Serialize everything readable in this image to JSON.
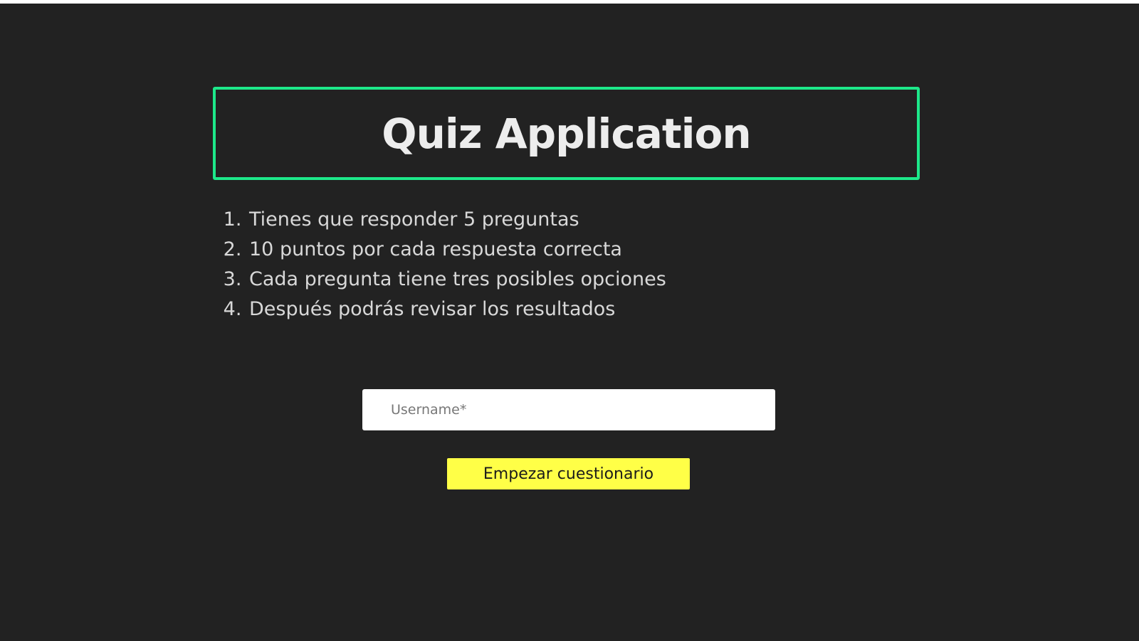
{
  "header": {
    "title": "Quiz Application"
  },
  "rules": [
    "Tienes que responder 5 preguntas",
    "10 puntos por cada respuesta correcta",
    "Cada pregunta tiene tres posibles opciones",
    "Después podrás revisar los resultados"
  ],
  "form": {
    "username_placeholder": "Username*",
    "username_value": "",
    "start_label": "Empezar cuestionario"
  },
  "colors": {
    "background": "#222222",
    "accent_border": "#1de88a",
    "button": "#ffff47",
    "text": "#ededed"
  }
}
